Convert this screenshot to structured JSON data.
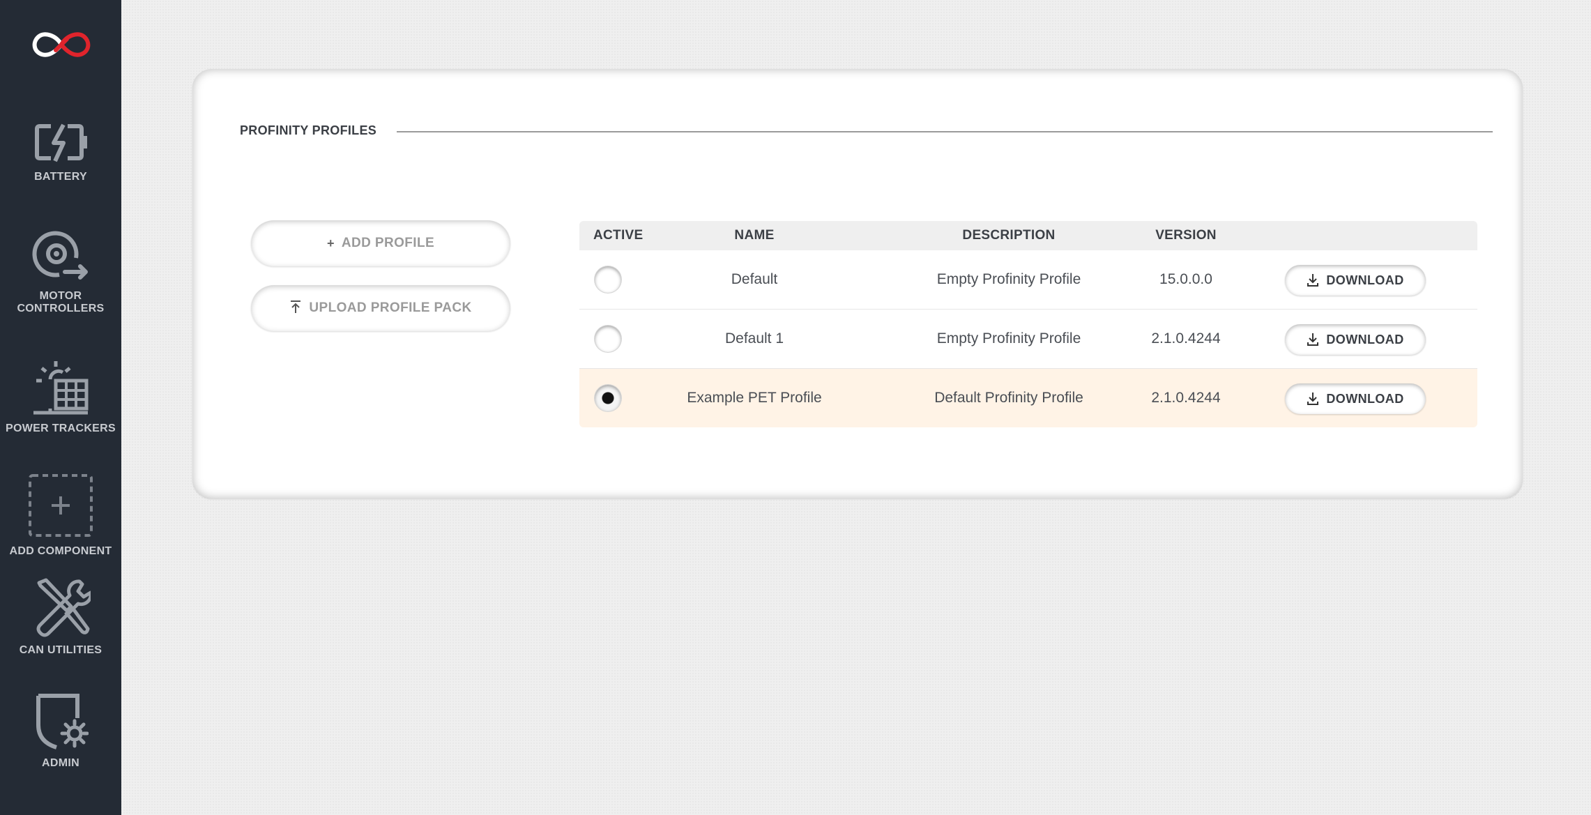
{
  "sidebar": {
    "items": [
      {
        "label": "BATTERY",
        "icon": "battery-icon"
      },
      {
        "label": "MOTOR\nCONTROLLERS",
        "icon": "motor-controller-icon"
      },
      {
        "label": "POWER TRACKERS",
        "icon": "power-tracker-icon"
      },
      {
        "label": "ADD COMPONENT",
        "icon": "add-component-icon"
      },
      {
        "label": "CAN UTILITIES",
        "icon": "can-utilities-icon"
      },
      {
        "label": "ADMIN",
        "icon": "admin-icon"
      }
    ]
  },
  "panel": {
    "title": "PROFINITY PROFILES",
    "add_profile_label": "ADD PROFILE",
    "upload_pack_label": "UPLOAD PROFILE PACK"
  },
  "table": {
    "headers": {
      "active": "ACTIVE",
      "name": "NAME",
      "description": "DESCRIPTION",
      "version": "VERSION"
    },
    "download_label": "DOWNLOAD",
    "rows": [
      {
        "name": "Default",
        "description": "Empty Profinity Profile",
        "version": "15.0.0.0",
        "active": false
      },
      {
        "name": "Default 1",
        "description": "Empty Profinity Profile",
        "version": "2.1.0.4244",
        "active": false
      },
      {
        "name": "Example PET Profile",
        "description": "Default Profinity Profile",
        "version": "2.1.0.4244",
        "active": true
      }
    ]
  },
  "colors": {
    "sidebar_bg": "#242b35",
    "logo_red": "#e0242c",
    "active_row_bg": "#fff3e6",
    "icon_gray": "#9aa0a8"
  }
}
